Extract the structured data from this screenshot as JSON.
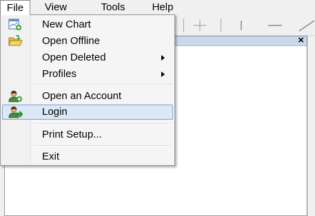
{
  "menubar": {
    "items": [
      {
        "label": "File",
        "open": true
      },
      {
        "label": "View",
        "open": false
      },
      {
        "label": "Tools",
        "open": false
      },
      {
        "label": "Help",
        "open": false
      }
    ]
  },
  "chart_window": {
    "close_glyph": "×"
  },
  "file_menu": {
    "items": [
      {
        "label": "New Chart",
        "icon": "new-chart-icon",
        "submenu": false
      },
      {
        "label": "Open Offline",
        "icon": "folder-open-icon",
        "submenu": false
      },
      {
        "label": "Open Deleted",
        "icon": "",
        "submenu": true
      },
      {
        "label": "Profiles",
        "icon": "",
        "submenu": true
      },
      {
        "label": "Open an Account",
        "icon": "user-add-icon",
        "submenu": false
      },
      {
        "label": "Login",
        "icon": "user-login-icon",
        "submenu": false,
        "highlighted": true
      },
      {
        "label": "Print Setup...",
        "icon": "",
        "submenu": false
      },
      {
        "label": "Exit",
        "icon": "",
        "submenu": false
      }
    ]
  },
  "colors": {
    "highlight_fill": "#dbe8f6",
    "highlight_border": "#7da2ce",
    "chart_titlebar": "#c9d9ec"
  }
}
